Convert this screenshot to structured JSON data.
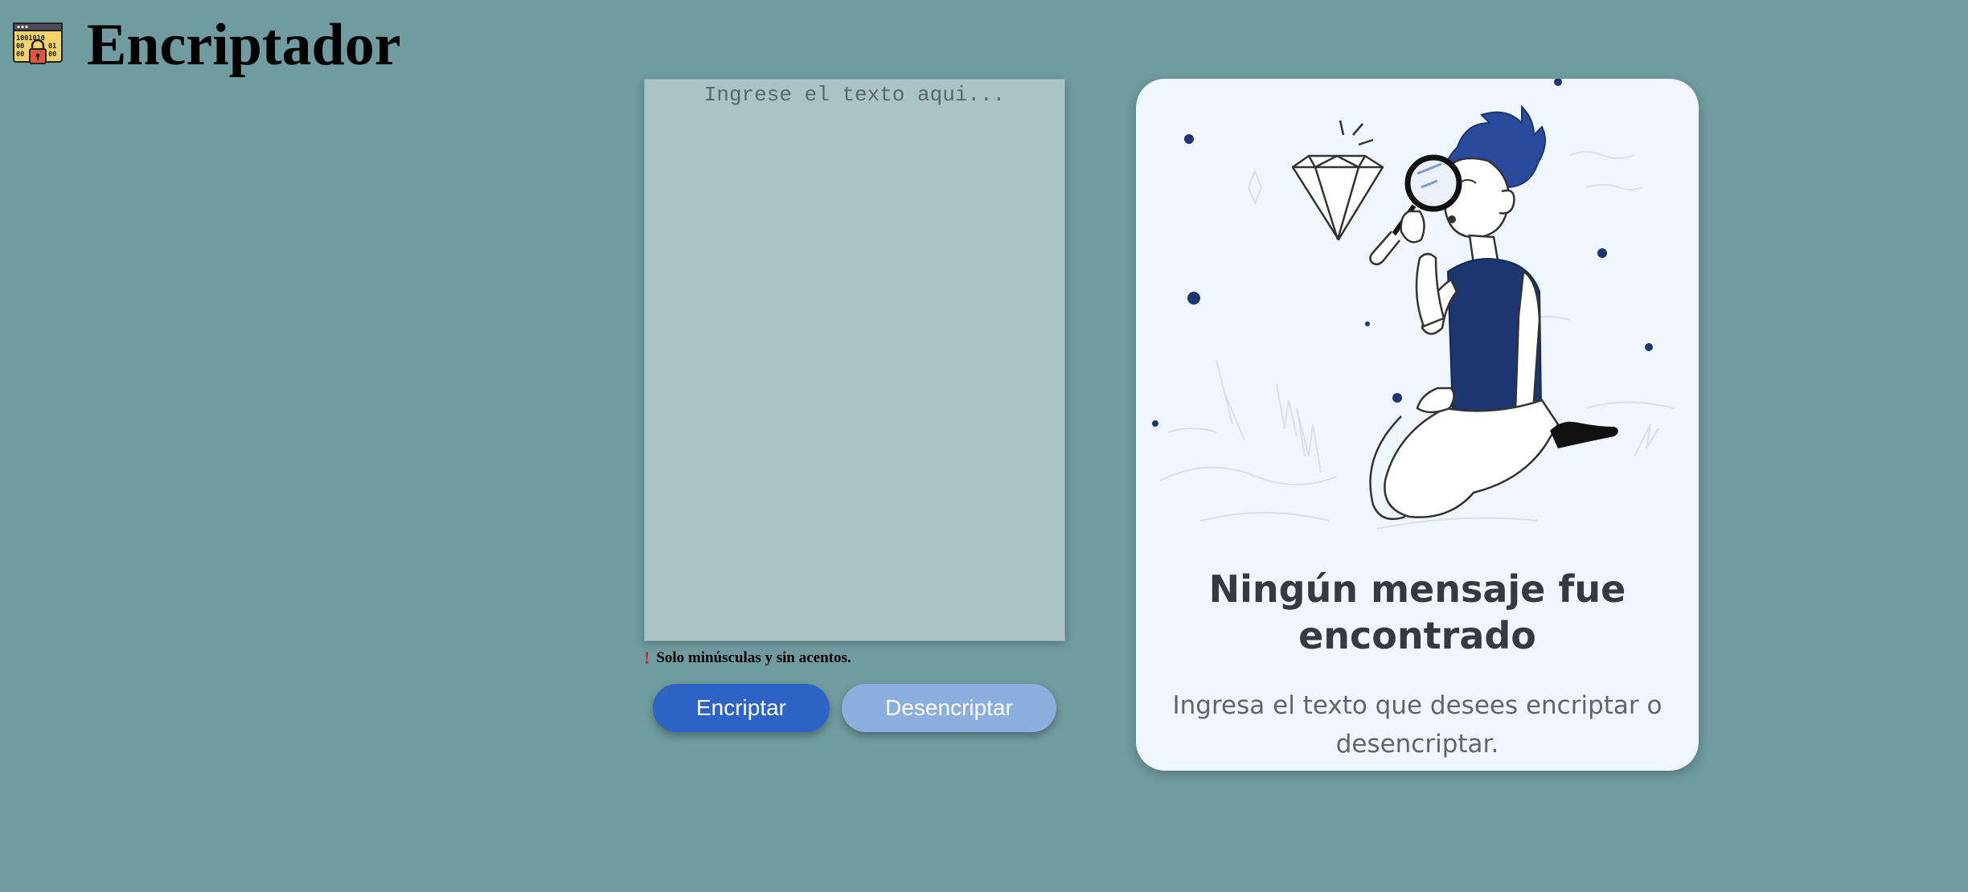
{
  "header": {
    "logo_icon": "binary-lock-icon",
    "title": "Encriptador"
  },
  "input": {
    "placeholder": "Ingrese el texto aqui...",
    "value": ""
  },
  "hint": {
    "icon": "exclamation-icon",
    "text": "Solo minúsculas y sin acentos."
  },
  "buttons": {
    "encrypt_label": "Encriptar",
    "decrypt_label": "Desencriptar"
  },
  "output": {
    "illustration": "person-with-magnifying-glass-and-diamond",
    "title": "Ningún mensaje fue encontrado",
    "text": "Ingresa el texto que desees encriptar o desencriptar."
  },
  "colors": {
    "background": "#709c9f",
    "input_bg": "#aac3c5",
    "encrypt_button": "#2c63c4",
    "decrypt_button": "#8caede",
    "card_bg": "#eff6fd",
    "accent_navy": "#1b3670",
    "hint_icon": "#d0201e"
  }
}
